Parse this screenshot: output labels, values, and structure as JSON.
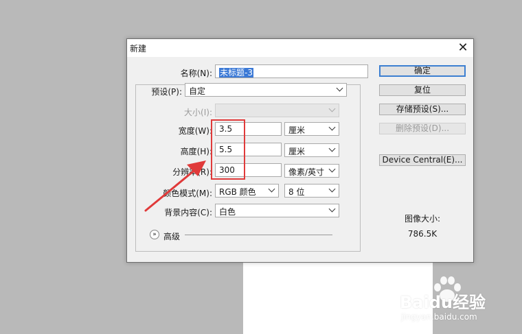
{
  "dialog": {
    "title": "新建",
    "close_glyph": "✕"
  },
  "name": {
    "label": "名称(N):",
    "value": "未标题-3"
  },
  "preset": {
    "label": "预设(P):",
    "value": "自定"
  },
  "size": {
    "label": "大小(I):",
    "value": ""
  },
  "width": {
    "label": "宽度(W):",
    "value": "3.5",
    "unit": "厘米"
  },
  "height": {
    "label": "高度(H):",
    "value": "5.5",
    "unit": "厘米"
  },
  "resolution": {
    "label": "分辨率(R):",
    "value": "300",
    "unit": "像素/英寸"
  },
  "color_mode": {
    "label": "颜色模式(M):",
    "value": "RGB 颜色",
    "depth": "8 位"
  },
  "background": {
    "label": "背景内容(C):",
    "value": "白色"
  },
  "advanced": {
    "label": "高级"
  },
  "buttons": {
    "ok": "确定",
    "reset": "复位",
    "save_preset": "存储预设(S)...",
    "delete_preset": "删除预设(D)...",
    "device_central": "Device Central(E)..."
  },
  "image_size": {
    "label": "图像大小:",
    "value": "786.5K"
  },
  "watermark": {
    "brand": "Baidu经验",
    "url": "jingyan.baidu.com"
  },
  "colors": {
    "accent": "#3c7fd1",
    "annotation": "#e03a3a"
  }
}
